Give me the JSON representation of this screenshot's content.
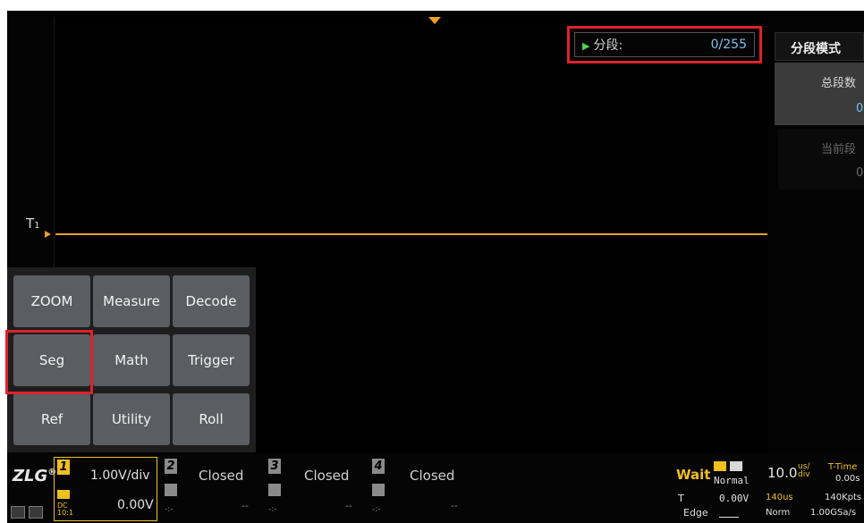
{
  "segment_readout": {
    "label": "分段:",
    "value": "0/255"
  },
  "side_menu": {
    "title": "分段模式",
    "items": [
      {
        "label": "总段数",
        "value": "0"
      },
      {
        "label": "当前段",
        "value": "0"
      }
    ]
  },
  "trigger_marker": {
    "label": "T",
    "sub": "1"
  },
  "quick_menu": {
    "buttons": [
      "ZOOM",
      "Measure",
      "Decode",
      "Seg",
      "Math",
      "Trigger",
      "Ref",
      "Utility",
      "Roll"
    ]
  },
  "logo": "ZLG",
  "channels": [
    {
      "num": "1",
      "scale": "1.00V/div",
      "offset": "0.00V",
      "coupling": "DC",
      "probe": "10:1",
      "color": "#f0c020"
    },
    {
      "num": "2",
      "status": "Closed",
      "offset": "--",
      "coupling": "-:-",
      "color": "#7a7a7a"
    },
    {
      "num": "3",
      "status": "Closed",
      "offset": "--",
      "coupling": "-:-",
      "color": "#7a7a7a"
    },
    {
      "num": "4",
      "status": "Closed",
      "offset": "--",
      "coupling": "-:-",
      "color": "#7a7a7a"
    }
  ],
  "acquisition": {
    "state": "Wait",
    "state_color": "#f0c020",
    "mode": "Normal",
    "trigger_type": "T",
    "trigger_level": "0.00V",
    "trigger_edge": "Edge",
    "timebase": "10.0",
    "timebase_unit_top": "us/",
    "timebase_unit_bottom": "div",
    "time_label": "T-Time",
    "time_value": "0.00s",
    "record_time": "140us",
    "record_points": "140Kpts",
    "trig_mode": "Norm",
    "sample_rate": "1.00GSa/s"
  },
  "colors": {
    "accent_red": "#e0212b",
    "trace": "#e8a02a",
    "value_blue": "#6ec0f5"
  }
}
